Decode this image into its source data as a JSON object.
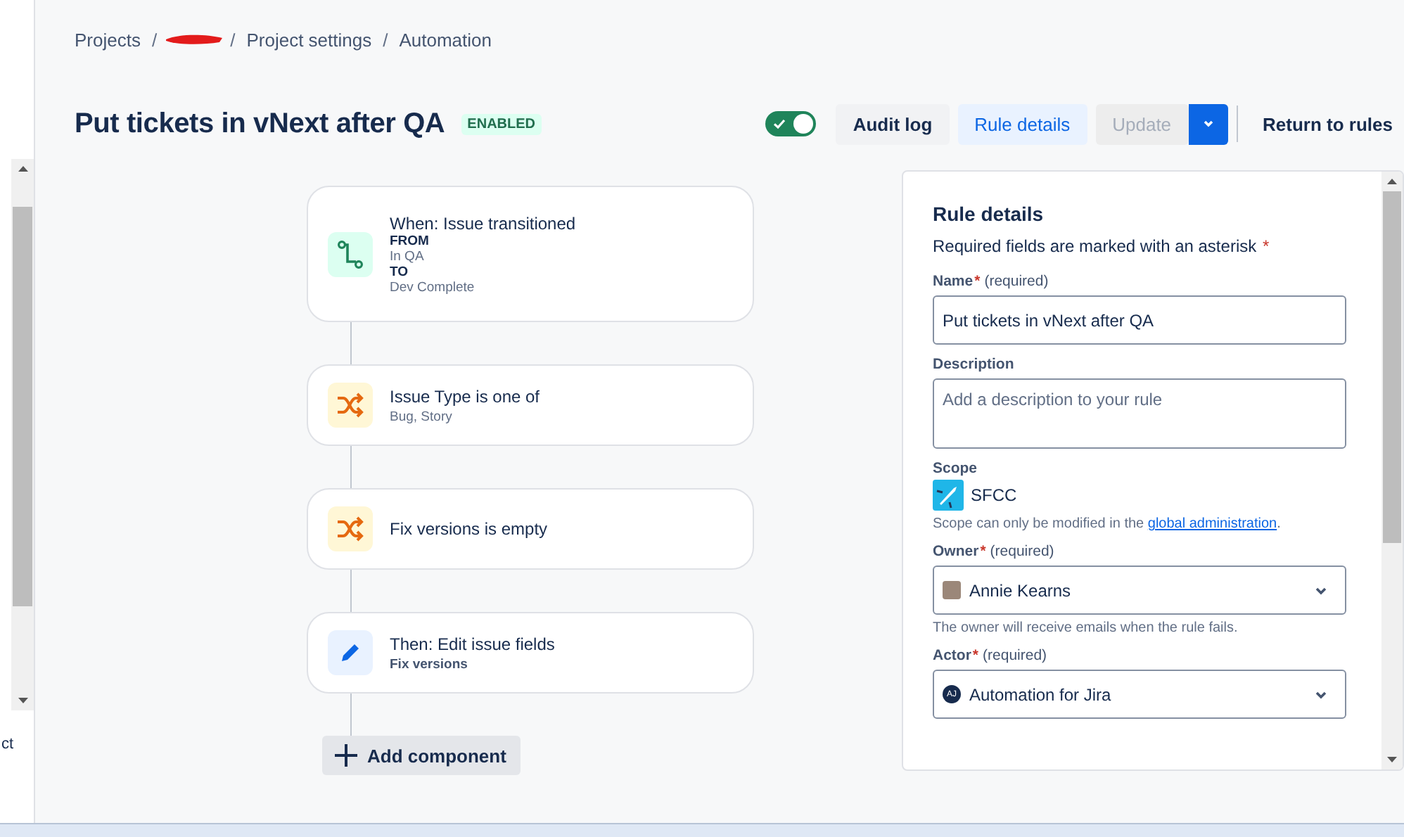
{
  "sidebar_fragment": {
    "text": "ct"
  },
  "breadcrumbs": [
    {
      "label": "Projects",
      "redacted": false
    },
    {
      "redacted": true
    },
    {
      "label": "Project settings",
      "redacted": false
    },
    {
      "label": "Automation",
      "redacted": false
    }
  ],
  "breadcrumb_separator": "/",
  "rule": {
    "title": "Put tickets in vNext after QA",
    "status": "ENABLED"
  },
  "toolbar": {
    "enabled_toggle": {
      "on": true
    },
    "buttons": [
      {
        "label": "Audit log",
        "kind": "subtle",
        "selected": false
      },
      {
        "label": "Rule details",
        "kind": "subtle",
        "selected": true
      },
      {
        "label": "Update",
        "kind": "split",
        "disabled": true
      },
      {
        "label": "Return to rules",
        "kind": "link"
      }
    ]
  },
  "steps": [
    {
      "kind": "trigger",
      "title": "When: Issue transitioned",
      "details": [
        {
          "text": "FROM",
          "strong": true
        },
        {
          "text": "In QA",
          "strong": false
        },
        {
          "text": "TO",
          "strong": true
        },
        {
          "text": "Dev Complete",
          "strong": false
        }
      ]
    },
    {
      "kind": "condition",
      "title": "Issue Type is one of",
      "details": [
        {
          "text": "Bug, Story",
          "strong": false
        }
      ]
    },
    {
      "kind": "condition",
      "title": "Fix versions is empty"
    },
    {
      "kind": "action",
      "title": "Then: Edit issue fields",
      "details": [
        {
          "text": "Fix versions",
          "strong": true
        }
      ]
    }
  ],
  "add_component": {
    "label": "Add component"
  },
  "details_panel": {
    "title": "Rule details",
    "intro": "Required fields are marked with an asterisk",
    "asterisk": "*",
    "fields": [
      {
        "kind": "text",
        "label": "Name",
        "required": true,
        "required_note": "(required)",
        "value": "Put tickets in vNext after QA"
      },
      {
        "kind": "textarea",
        "label": "Description",
        "placeholder": "Add a description to your rule"
      },
      {
        "kind": "scope",
        "label": "Scope",
        "value": "SFCC",
        "help": "Scope can only be modified in the ",
        "link": "global administration",
        "help_end": "."
      },
      {
        "kind": "select",
        "label": "Owner",
        "required": true,
        "required_note": "(required)",
        "value": "Annie Kearns",
        "help": "The owner will receive emails when the rule fails."
      },
      {
        "kind": "select",
        "label": "Actor",
        "required": true,
        "required_note": "(required)",
        "value": "Automation for Jira",
        "initials": "AJ"
      }
    ]
  }
}
